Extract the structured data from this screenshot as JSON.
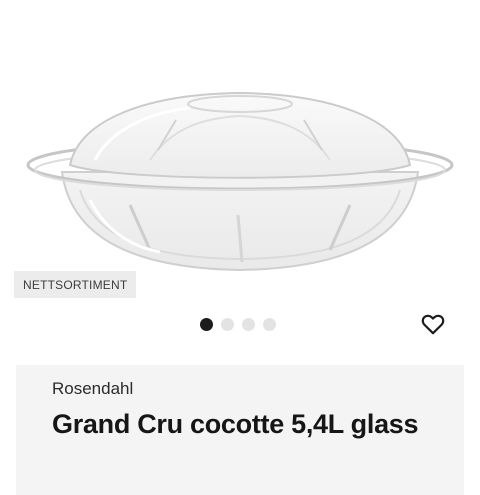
{
  "product": {
    "badge": "NETTSORTIMENT",
    "brand": "Rosendahl",
    "title": "Grand Cru cocotte 5,4L glass"
  },
  "carousel": {
    "count": 4,
    "active_index": 0
  },
  "icons": {
    "wishlist": "heart-outline-icon"
  },
  "colors": {
    "card_background": "#f4f4f4",
    "badge_background": "#ececec",
    "dot_active": "#1c1c1c",
    "dot_inactive": "#e3e3e3"
  }
}
